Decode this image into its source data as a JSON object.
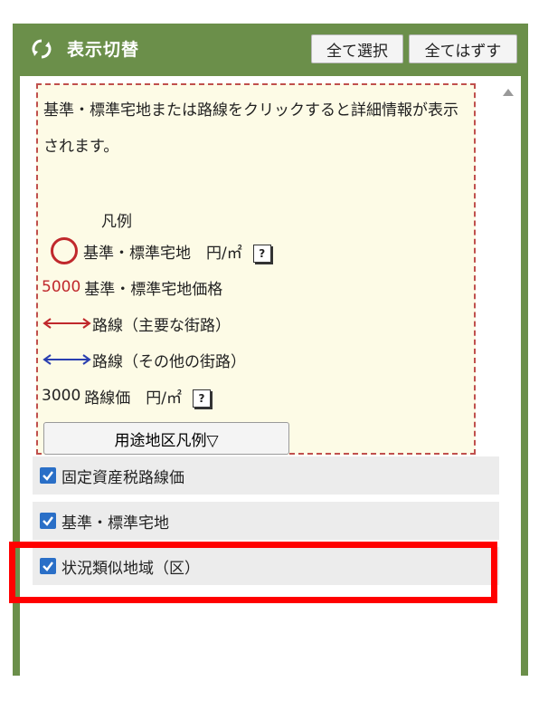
{
  "header": {
    "title": "表示切替",
    "select_all": "全て選択",
    "clear_all": "全てはずす"
  },
  "info": {
    "description": "基準・標準宅地または路線をクリックすると詳細情報が表示されます。",
    "legend_title": "凡例",
    "legend": {
      "standard_land": "基準・標準宅地　円/㎡",
      "price_sample": "5000",
      "price_label": "基準・標準宅地価格",
      "route_main": "路線（主要な街路）",
      "route_other": "路線（その他の街路）",
      "route_price_sample": "3000",
      "route_price_label": "路線価　円/㎡",
      "help_glyph": "?"
    },
    "usage_button": "用途地区凡例▽"
  },
  "layers": [
    {
      "label": "固定資産税路線価",
      "checked": true
    },
    {
      "label": "基準・標準宅地",
      "checked": true
    },
    {
      "label": "状況類似地域（区）",
      "checked": true
    }
  ],
  "colors": {
    "panel": "#6b8f4a",
    "main_route": "#c0282c",
    "other_route": "#2a3fb0",
    "checkbox": "#2a6fc7",
    "highlight": "#ff0000"
  }
}
